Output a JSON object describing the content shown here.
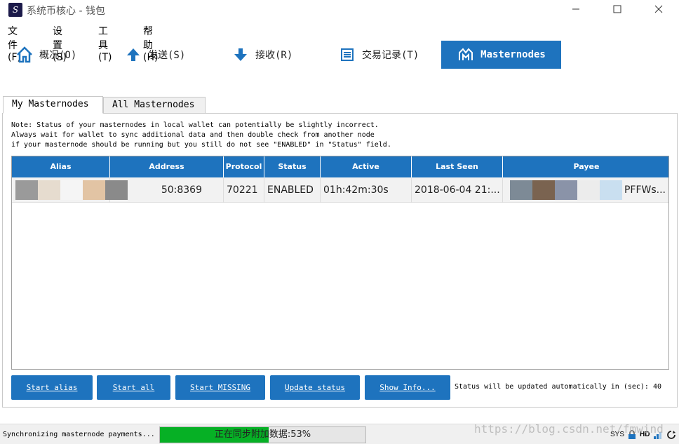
{
  "window": {
    "title": "系统币核心 - 钱包",
    "app_icon_glyph": "S"
  },
  "menu": [
    "文件(F)",
    "设置(S)",
    "工具(T)",
    "帮助(H)"
  ],
  "toolbar": [
    {
      "label": "概况(O)",
      "icon": "home-icon"
    },
    {
      "label": "发送(S)",
      "icon": "arrow-up-icon"
    },
    {
      "label": "接收(R)",
      "icon": "arrow-down-icon"
    },
    {
      "label": "交易记录(T)",
      "icon": "list-icon"
    },
    {
      "label": "Masternodes",
      "icon": "masternode-icon"
    }
  ],
  "tabs": [
    "My Masternodes",
    "All Masternodes"
  ],
  "note": [
    "Note: Status of your masternodes in local wallet can potentially be slightly incorrect.",
    "Always wait for wallet to sync additional data and then double check from another node",
    "if your masternode should be running but you still do not see \"ENABLED\" in \"Status\" field."
  ],
  "table": {
    "columns": [
      "Alias",
      "Address",
      "Protocol",
      "Status",
      "Active",
      "Last Seen",
      "Payee"
    ],
    "rows": [
      {
        "alias": "",
        "address": "50:8369",
        "protocol": "70221",
        "status": "ENABLED",
        "active": "01h:42m:30s",
        "last_seen": "2018-06-04 21:...",
        "payee": "PFFWs..."
      }
    ]
  },
  "buttons": {
    "start_alias": "Start alias",
    "start_all": "Start all",
    "start_missing": "Start MISSING",
    "update_status": "Update status",
    "show_info": "Show Info..."
  },
  "auto_status": "Status will be updated automatically in (sec): 40",
  "statusbar": {
    "sync_text": "Synchronizing masternode payments...",
    "progress_text": "正在同步附加数据:53%",
    "progress_percent": 53,
    "sys_label": "SYS",
    "hd_label": "HD"
  },
  "watermark": "https://blog.csdn.net/fmwind",
  "colors": {
    "accent": "#1e73be",
    "progress": "#06b025"
  }
}
